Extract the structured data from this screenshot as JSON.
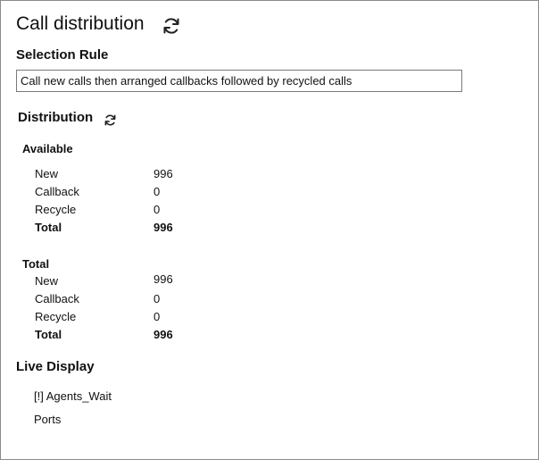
{
  "title": "Call distribution",
  "icons": {
    "refresh": "refresh-icon"
  },
  "selection_rule": {
    "heading": "Selection Rule",
    "value": "Call new calls then arranged callbacks followed by recycled calls"
  },
  "distribution": {
    "heading": "Distribution",
    "available": {
      "heading": "Available",
      "rows": [
        {
          "label": "New",
          "value": "996"
        },
        {
          "label": "Callback",
          "value": "0"
        },
        {
          "label": "Recycle",
          "value": "0"
        },
        {
          "label": "Total",
          "value": "996"
        }
      ]
    },
    "total": {
      "heading": "Total",
      "rows": [
        {
          "label": "New",
          "value": "996"
        },
        {
          "label": "Callback",
          "value": "0"
        },
        {
          "label": "Recycle",
          "value": "0"
        },
        {
          "label": "Total",
          "value": "996"
        }
      ]
    }
  },
  "live_display": {
    "heading": "Live Display",
    "items": [
      {
        "label": "[!] Agents_Wait"
      },
      {
        "label": "Ports"
      }
    ]
  }
}
